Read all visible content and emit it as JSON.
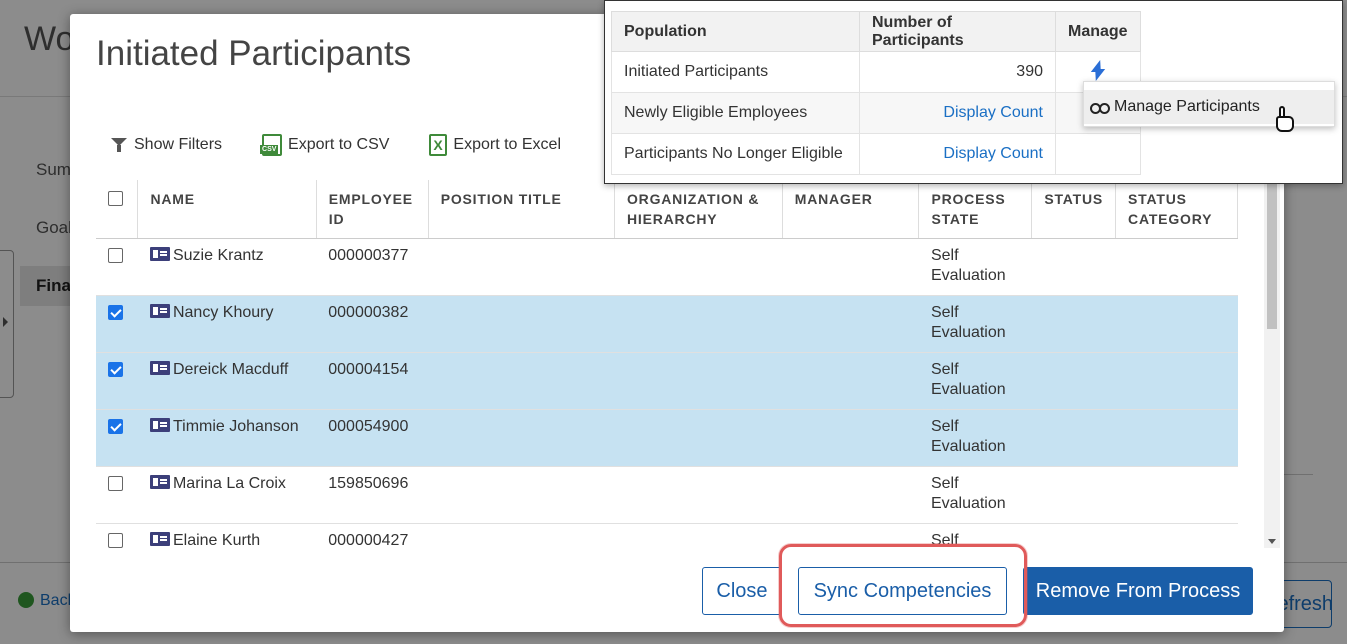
{
  "background": {
    "title": "Wo",
    "nav": [
      "Sum",
      "Goal",
      "Fina"
    ],
    "back_label": "Back",
    "refresh_label": "Refresh"
  },
  "modal": {
    "title": "Initiated Participants",
    "toolbar": {
      "filters": "Show Filters",
      "csv": "Export to CSV",
      "csv_badge": "CSV",
      "excel": "Export to Excel",
      "excel_badge": "X"
    },
    "columns": [
      "NAME",
      "EMPLOYEE ID",
      "POSITION TITLE",
      "ORGANIZATION & HIERARCHY",
      "MANAGER",
      "PROCESS STATE",
      "STATUS",
      "STATUS CATEGORY"
    ],
    "rows": [
      {
        "name": "Suzie Krantz",
        "id": "000000377",
        "state": "Self Evaluation",
        "selected": false
      },
      {
        "name": "Nancy Khoury",
        "id": "000000382",
        "state": "Self Evaluation",
        "selected": true
      },
      {
        "name": "Dereick Macduff",
        "id": "000004154",
        "state": "Self Evaluation",
        "selected": true
      },
      {
        "name": "Timmie Johanson",
        "id": "000054900",
        "state": "Self Evaluation",
        "selected": true
      },
      {
        "name": "Marina La Croix",
        "id": "159850696",
        "state": "Self Evaluation",
        "selected": false
      },
      {
        "name": "Elaine Kurth",
        "id": "000000427",
        "state": "Self",
        "selected": false
      }
    ],
    "buttons": {
      "close": "Close",
      "sync": "Sync Competencies",
      "remove": "Remove From Process"
    }
  },
  "population": {
    "headers": [
      "Population",
      "Number of Participants",
      "Manage"
    ],
    "rows": [
      {
        "population": "Initiated Participants",
        "count": "390"
      },
      {
        "population": "Newly Eligible Employees",
        "count": "Display Count"
      },
      {
        "population": "Participants No Longer Eligible",
        "count": "Display Count"
      }
    ],
    "menu_item": "Manage Participants"
  },
  "colors": {
    "primary": "#1a5ea8",
    "selected_row": "#c6e2f2",
    "highlight": "#e05a5a"
  }
}
